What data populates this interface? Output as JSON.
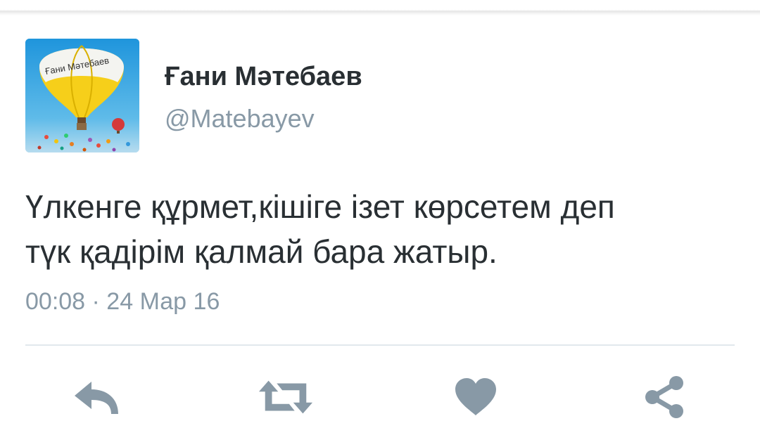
{
  "tweet": {
    "display_name": "Ғани Мәтебаев",
    "handle": "@Matebayev",
    "text_lines": [
      "Үлкенге құрмет,кішіге ізет көрсетем деп",
      "түк қадірім қалмай бара жатыр."
    ],
    "timestamp": "00:08 · 24 Мар 16",
    "avatar_balloon_text": "Ғани Мәтебаев"
  },
  "actions": [
    {
      "name": "reply",
      "icon": "reply-icon"
    },
    {
      "name": "retweet",
      "icon": "retweet-icon"
    },
    {
      "name": "like",
      "icon": "heart-icon"
    },
    {
      "name": "share",
      "icon": "share-icon"
    }
  ],
  "colors": {
    "primary_text": "#292f33",
    "secondary_text": "#8899a6",
    "icon": "#8899a6",
    "divider": "#e1e8ed"
  }
}
